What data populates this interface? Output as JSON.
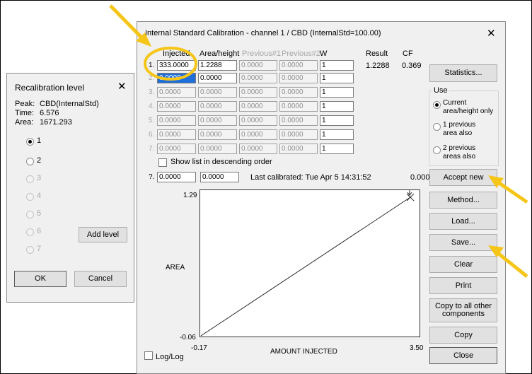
{
  "recalibration": {
    "title": "Recalibration level",
    "close_label": "✕",
    "peak_label": "Peak:",
    "peak_value": "CBD(InternalStd)",
    "time_label": "Time:",
    "time_value": "6.576",
    "area_label": "Area:",
    "area_value": "1671.293",
    "levels": [
      "1",
      "2",
      "3",
      "4",
      "5",
      "6",
      "7"
    ],
    "selected_level": "1",
    "add_level_label": "Add level",
    "ok_label": "OK",
    "cancel_label": "Cancel"
  },
  "calibration": {
    "title": "Internal Standard Calibration - channel 1 / CBD (InternalStd=100.00)",
    "close_label": "✕",
    "headers": {
      "injected": "Injected",
      "area_height": "Area/height",
      "previous1": "Previous#1",
      "previous2": "Previous#2",
      "w": "W",
      "result": "Result",
      "cf": "CF"
    },
    "rows": [
      {
        "n": "1.",
        "injected": "333.0000",
        "area": "1.2288",
        "prev1": "0.0000",
        "prev2": "0.0000",
        "w": "1",
        "result": "1.2288",
        "cf": "0.369"
      },
      {
        "n": "2.",
        "injected": "0.0000",
        "area": "0.0000",
        "prev1": "0.0000",
        "prev2": "0.0000",
        "w": "1",
        "result": "",
        "cf": ""
      },
      {
        "n": "3.",
        "injected": "0.0000",
        "area": "0.0000",
        "prev1": "0.0000",
        "prev2": "0.0000",
        "w": "1",
        "result": "",
        "cf": ""
      },
      {
        "n": "4.",
        "injected": "0.0000",
        "area": "0.0000",
        "prev1": "0.0000",
        "prev2": "0.0000",
        "w": "1",
        "result": "",
        "cf": ""
      },
      {
        "n": "5.",
        "injected": "0.0000",
        "area": "0.0000",
        "prev1": "0.0000",
        "prev2": "0.0000",
        "w": "1",
        "result": "",
        "cf": ""
      },
      {
        "n": "6.",
        "injected": "0.0000",
        "area": "0.0000",
        "prev1": "0.0000",
        "prev2": "0.0000",
        "w": "1",
        "result": "",
        "cf": ""
      },
      {
        "n": "7.",
        "injected": "0.0000",
        "area": "0.0000",
        "prev1": "0.0000",
        "prev2": "0.0000",
        "w": "1",
        "result": "",
        "cf": ""
      }
    ],
    "descending_label": "Show list in descending order",
    "unknown_row": {
      "n": "?.",
      "injected": "0.0000",
      "area": "0.0000"
    },
    "last_calibrated": "Last calibrated:  Tue Apr  5 14:31:52",
    "last_value": "0.000",
    "statistics_label": "Statistics...",
    "use_group": {
      "title": "Use",
      "options": [
        "Current area/height only",
        "1 previous area also",
        "2 previous areas also"
      ],
      "selected": "Current area/height only"
    },
    "buttons": {
      "accept_new": "Accept new",
      "method": "Method...",
      "load": "Load...",
      "save": "Save...",
      "clear": "Clear",
      "print": "Print",
      "copy_all": "Copy to all other components",
      "copy": "Copy",
      "close": "Close"
    },
    "plot": {
      "y_max_label": "1.29",
      "y_min_label": "-0.06",
      "x_min_label": "-0.17",
      "x_max_label": "3.50",
      "ylabel": "AREA",
      "xlabel": "AMOUNT INJECTED"
    },
    "loglog_label": "Log/Log"
  },
  "colors": {
    "annotation_arrow": "#f5c518",
    "selection": "#1e6fd9"
  }
}
